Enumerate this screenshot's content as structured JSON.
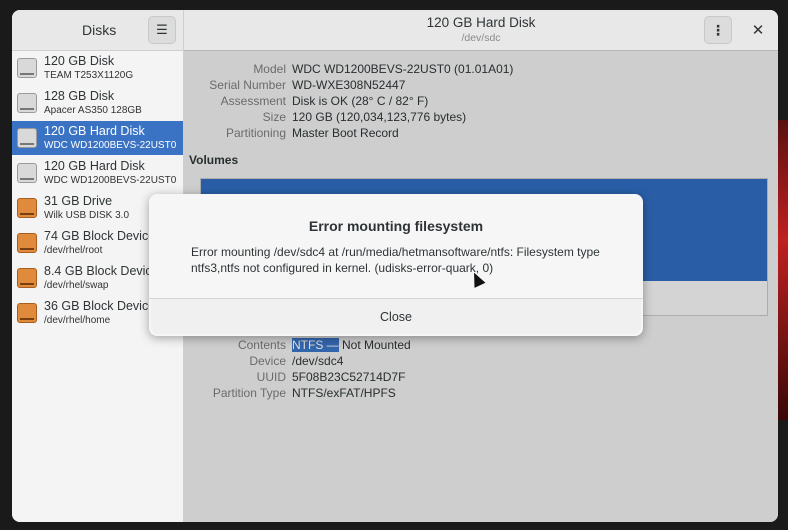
{
  "sidebar": {
    "title": "Disks",
    "devices": [
      {
        "name": "120 GB Disk",
        "sub": "TEAM T253X1120G",
        "type": "disk"
      },
      {
        "name": "128 GB Disk",
        "sub": "Apacer AS350 128GB",
        "type": "disk"
      },
      {
        "name": "120 GB Hard Disk",
        "sub": "WDC WD1200BEVS-22UST0",
        "type": "disk",
        "selected": true
      },
      {
        "name": "120 GB Hard Disk",
        "sub": "WDC WD1200BEVS-22UST0",
        "type": "disk"
      },
      {
        "name": "31 GB Drive",
        "sub": "Wilk USB DISK 3.0",
        "type": "drive"
      },
      {
        "name": "74 GB Block Device",
        "sub": "/dev/rhel/root",
        "type": "block"
      },
      {
        "name": "8.4 GB Block Device",
        "sub": "/dev/rhel/swap",
        "type": "block"
      },
      {
        "name": "36 GB Block Device",
        "sub": "/dev/rhel/home",
        "type": "block"
      }
    ]
  },
  "main": {
    "title": "120 GB Hard Disk",
    "subtitle": "/dev/sdc",
    "props": {
      "model_label": "Model",
      "model": "WDC WD1200BEVS-22UST0 (01.01A01)",
      "serial_label": "Serial Number",
      "serial": "WD-WXE308N52447",
      "assess_label": "Assessment",
      "assess": "Disk is OK (28° C / 82° F)",
      "size_label": "Size",
      "size": "120 GB (120,034,123,776 bytes)",
      "part_label": "Partitioning",
      "part": "Master Boot Record"
    },
    "volumes_heading": "Volumes",
    "volume": {
      "contents_label": "Contents",
      "contents_highlight": "NTFS —",
      "contents_rest": " Not Mounted",
      "device_label": "Device",
      "device": "/dev/sdc4",
      "uuid_label": "UUID",
      "uuid": "5F08B23C52714D7F",
      "ptype_label": "Partition Type",
      "ptype": "NTFS/exFAT/HPFS"
    }
  },
  "dialog": {
    "title": "Error mounting filesystem",
    "body": "Error mounting /dev/sdc4 at /run/media/hetmansoftware/ntfs: Filesystem type ntfs3,ntfs not configured in kernel. (udisks-error-quark, 0)",
    "close_label": "Close"
  },
  "icons": {
    "menu": "hamburger-icon",
    "kebab": "vertical-dots-icon",
    "close": "close-icon"
  }
}
